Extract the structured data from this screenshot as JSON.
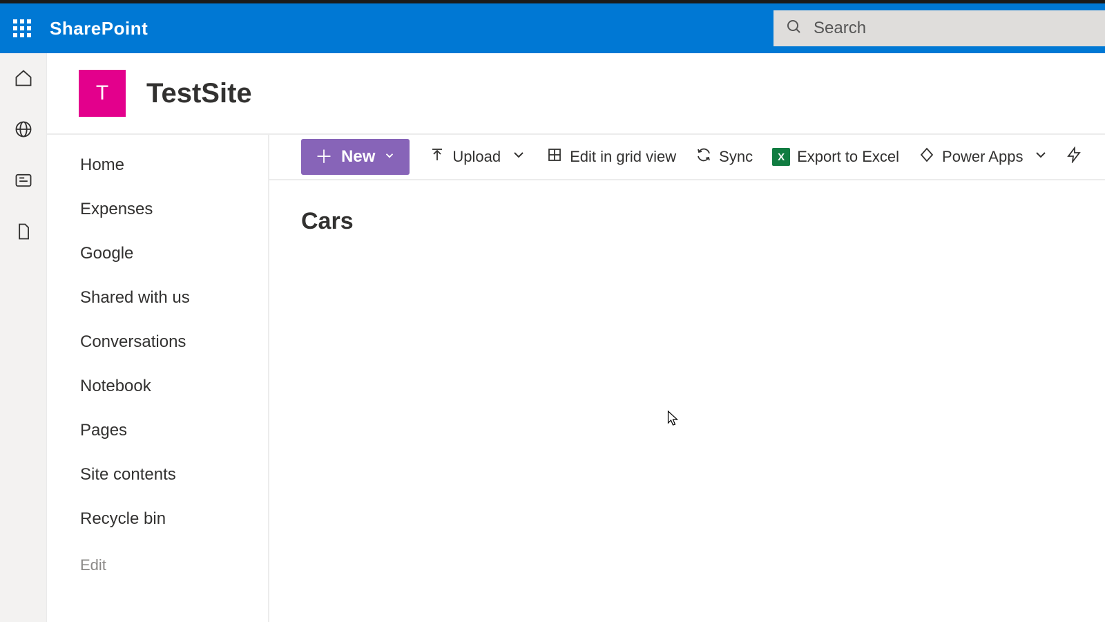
{
  "header": {
    "brand": "SharePoint",
    "search_placeholder": "Search"
  },
  "site": {
    "logo_letter": "T",
    "title": "TestSite"
  },
  "nav": {
    "items": [
      "Home",
      "Expenses",
      "Google",
      "Shared with us",
      "Conversations",
      "Notebook",
      "Pages",
      "Site contents",
      "Recycle bin"
    ],
    "edit_label": "Edit"
  },
  "toolbar": {
    "new_label": "New",
    "upload_label": "Upload",
    "edit_grid_label": "Edit in grid view",
    "sync_label": "Sync",
    "export_label": "Export to Excel",
    "powerapps_label": "Power Apps"
  },
  "list": {
    "title": "Cars"
  }
}
